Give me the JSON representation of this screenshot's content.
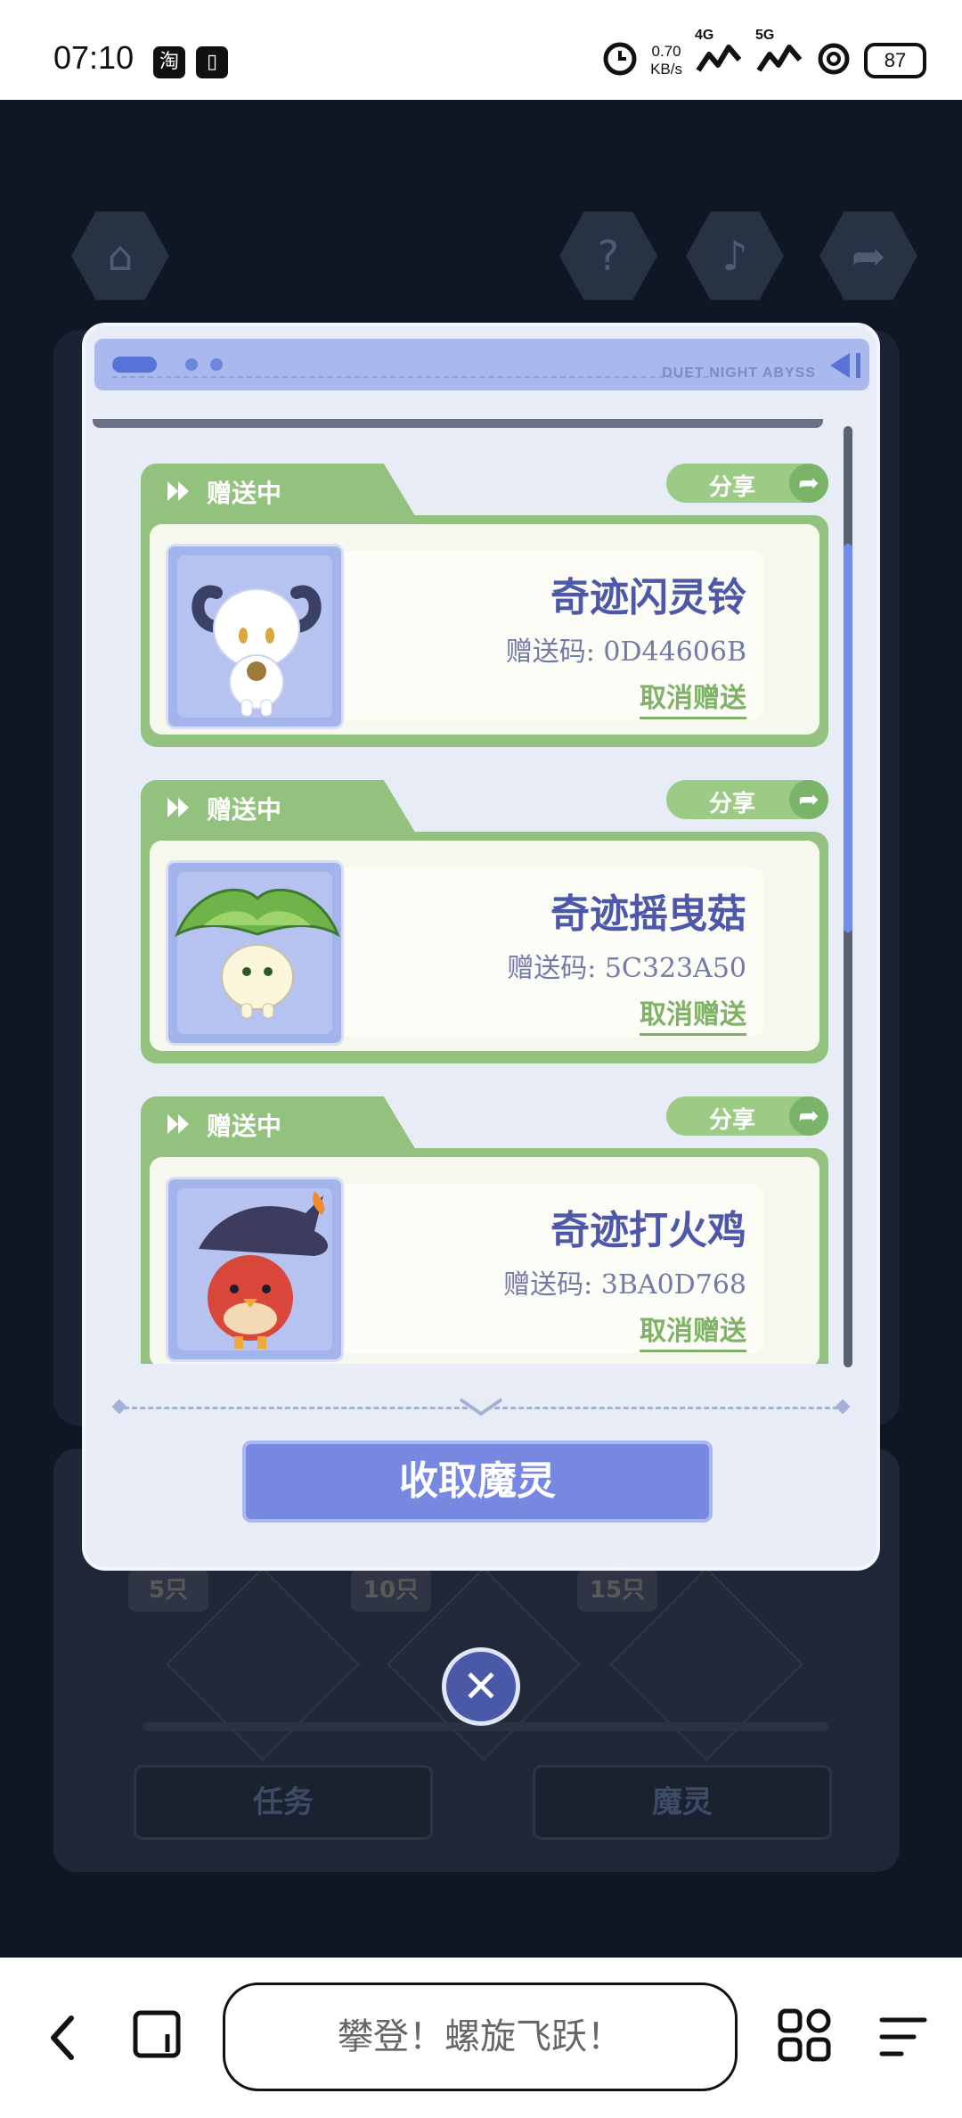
{
  "status_bar": {
    "time": "07:10",
    "app_icons": [
      "淘",
      "▯"
    ],
    "net_speed_value": "0.70",
    "net_speed_unit": "KB/s",
    "signal_1": "4G",
    "signal_2": "5G",
    "battery": "87"
  },
  "background_app": {
    "tags": [
      "5只",
      "10只",
      "15只"
    ],
    "buttons": [
      "任务",
      "魔灵"
    ]
  },
  "dialog": {
    "brand": "DUET NIGHT ABYSS",
    "items": [
      {
        "status": "赠送中",
        "share": "分享",
        "name": "奇迹闪灵铃",
        "code": "赠送码: 0D44606B",
        "cancel": "取消赠送",
        "icon": "goat-spirit-icon"
      },
      {
        "status": "赠送中",
        "share": "分享",
        "name": "奇迹摇曳菇",
        "code": "赠送码: 5C323A50",
        "cancel": "取消赠送",
        "icon": "mushroom-spirit-icon"
      },
      {
        "status": "赠送中",
        "share": "分享",
        "name": "奇迹打火鸡",
        "code": "赠送码: 3BA0D768",
        "cancel": "取消赠送",
        "icon": "fire-chick-spirit-icon"
      }
    ],
    "collect_button": "收取魔灵"
  },
  "close_button": "✕",
  "browser_bar": {
    "search_text": "攀登！螺旋飞跃！"
  }
}
